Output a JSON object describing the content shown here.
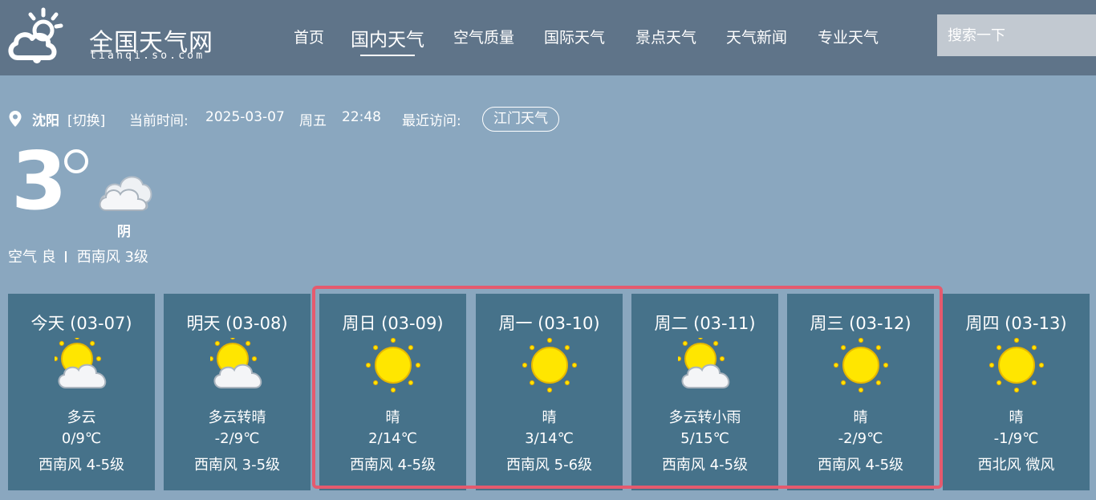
{
  "header": {
    "logo_title": "全国天气网",
    "logo_sub": "tianqi.so.com",
    "nav": [
      {
        "label": "首页",
        "active": false
      },
      {
        "label": "国内天气",
        "active": true
      },
      {
        "label": "空气质量",
        "active": false
      },
      {
        "label": "国际天气",
        "active": false
      },
      {
        "label": "景点天气",
        "active": false
      },
      {
        "label": "天气新闻",
        "active": false
      },
      {
        "label": "专业天气",
        "active": false
      }
    ],
    "search_placeholder": "搜索一下"
  },
  "info": {
    "city": "沈阳",
    "switch_label": "[切换]",
    "time_label": "当前时间:",
    "date": "2025-03-07",
    "weekday": "周五",
    "time": "22:48",
    "recent_label": "最近访问:",
    "recent_city": "江门天气"
  },
  "current": {
    "temp": "3",
    "condition": "阴",
    "air": "空气 良",
    "wind": "西南风 3级"
  },
  "forecast": [
    {
      "date": "今天 (03-07)",
      "icon": "partly-cloudy-icon",
      "condition": "多云",
      "temp": "0/9℃",
      "wind": "西南风 4-5级"
    },
    {
      "date": "明天 (03-08)",
      "icon": "partly-cloudy-icon",
      "condition": "多云转晴",
      "temp": "-2/9℃",
      "wind": "西南风 3-5级"
    },
    {
      "date": "周日 (03-09)",
      "icon": "sunny-icon",
      "condition": "晴",
      "temp": "2/14℃",
      "wind": "西南风 4-5级"
    },
    {
      "date": "周一 (03-10)",
      "icon": "sunny-icon",
      "condition": "晴",
      "temp": "3/14℃",
      "wind": "西南风 5-6级"
    },
    {
      "date": "周二 (03-11)",
      "icon": "partly-cloudy-icon",
      "condition": "多云转小雨",
      "temp": "5/15℃",
      "wind": "西南风 4-5级"
    },
    {
      "date": "周三 (03-12)",
      "icon": "sunny-icon",
      "condition": "晴",
      "temp": "-2/9℃",
      "wind": "西南风 4-5级"
    },
    {
      "date": "周四 (03-13)",
      "icon": "sunny-icon",
      "condition": "晴",
      "temp": "-1/9℃",
      "wind": "西北风 微风"
    }
  ],
  "colors": {
    "page_bg": "#8aa7bf",
    "header_bg": "#5f7489",
    "card_bg": "#46728a",
    "highlight": "#e55a6e",
    "sun": "#ffe600"
  }
}
